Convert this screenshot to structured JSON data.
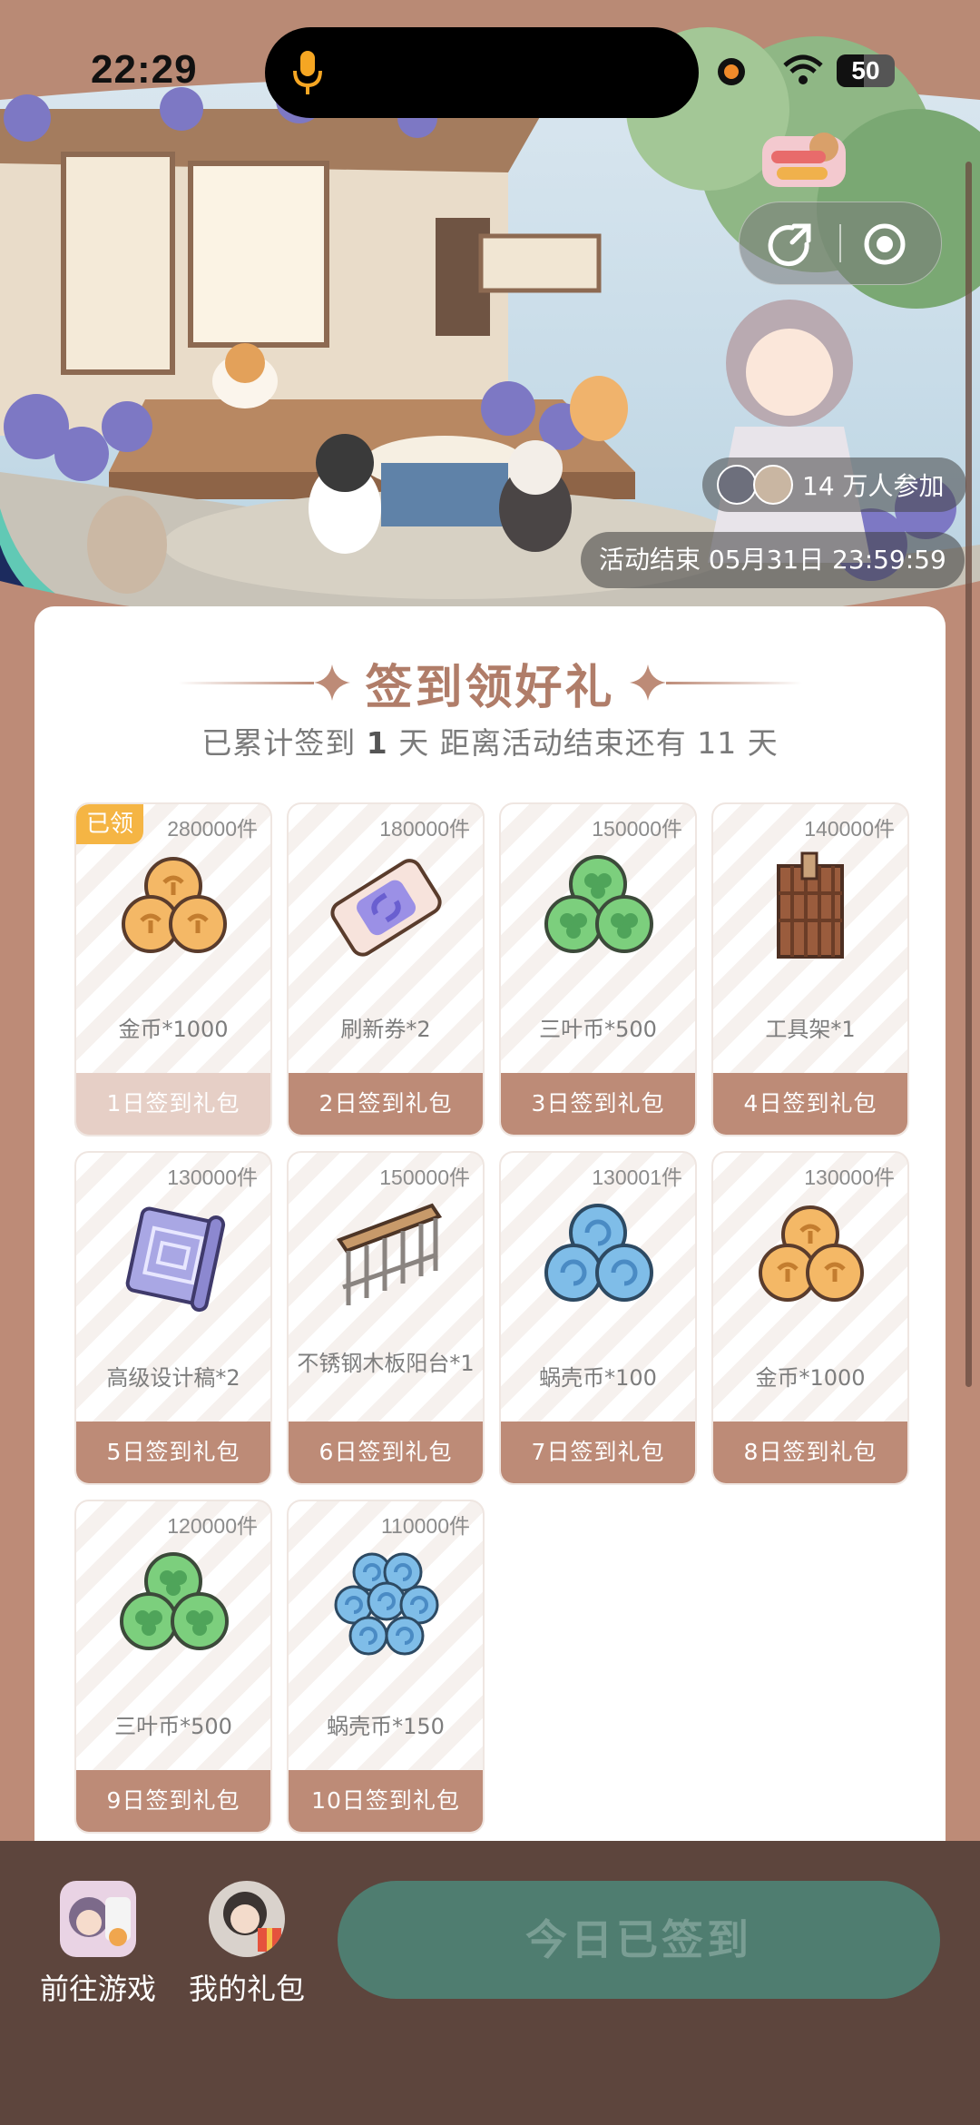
{
  "status_bar": {
    "time": "22:29",
    "battery": "50"
  },
  "banner": {
    "participants": "14 万人参加",
    "end_time": "活动结束 05月31日 23:59:59"
  },
  "card": {
    "title": "签到领好礼",
    "subtitle_prefix": "已累计签到",
    "days_signed": "1",
    "subtitle_mid": "天  距离活动结束还有 11 天"
  },
  "rewards": [
    {
      "count": "280000件",
      "name": "金币*1000",
      "pack": "1日签到礼包",
      "claimed": true,
      "badge": "已领",
      "icon": "gold-coin-icon"
    },
    {
      "count": "180000件",
      "name": "刷新券*2",
      "pack": "2日签到礼包",
      "claimed": false,
      "icon": "refresh-ticket-icon"
    },
    {
      "count": "150000件",
      "name": "三叶币*500",
      "pack": "3日签到礼包",
      "claimed": false,
      "icon": "clover-coin-icon"
    },
    {
      "count": "140000件",
      "name": "工具架*1",
      "pack": "4日签到礼包",
      "claimed": false,
      "icon": "tool-rack-icon"
    },
    {
      "count": "130000件",
      "name": "高级设计稿*2",
      "pack": "5日签到礼包",
      "claimed": false,
      "icon": "blueprint-icon"
    },
    {
      "count": "150000件",
      "name": "不锈钢木板阳台*1",
      "pack": "6日签到礼包",
      "claimed": false,
      "icon": "balcony-icon"
    },
    {
      "count": "130001件",
      "name": "蜗壳币*100",
      "pack": "7日签到礼包",
      "claimed": false,
      "icon": "shell-coin-icon"
    },
    {
      "count": "130000件",
      "name": "金币*1000",
      "pack": "8日签到礼包",
      "claimed": false,
      "icon": "gold-coin-icon"
    },
    {
      "count": "120000件",
      "name": "三叶币*500",
      "pack": "9日签到礼包",
      "claimed": false,
      "icon": "clover-coin-icon"
    },
    {
      "count": "110000件",
      "name": "蜗壳币*150",
      "pack": "10日签到礼包",
      "claimed": false,
      "icon": "shell-coin-pile-icon"
    }
  ],
  "bottom_bar": {
    "go_game": "前往游戏",
    "my_gifts": "我的礼包",
    "sign_button": "今日已签到"
  },
  "colors": {
    "accent": "#bd8b77",
    "claimed_pack": "#e6cfc6",
    "badge": "#f5b544",
    "bottom_bar": "#5d453d",
    "sign_button": "#4f7d70"
  }
}
